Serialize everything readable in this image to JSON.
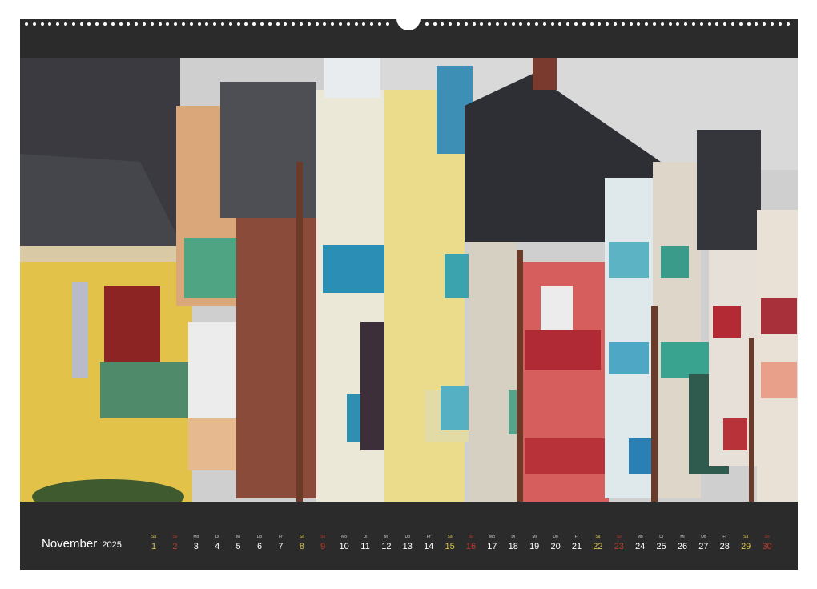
{
  "calendar": {
    "month": "November",
    "year": "2025",
    "days": [
      {
        "abbr": "Sa",
        "num": "1",
        "type": "sat"
      },
      {
        "abbr": "So",
        "num": "2",
        "type": "sun"
      },
      {
        "abbr": "Mo",
        "num": "3",
        "type": "week"
      },
      {
        "abbr": "Di",
        "num": "4",
        "type": "week"
      },
      {
        "abbr": "Mi",
        "num": "5",
        "type": "week"
      },
      {
        "abbr": "Do",
        "num": "6",
        "type": "week"
      },
      {
        "abbr": "Fr",
        "num": "7",
        "type": "week"
      },
      {
        "abbr": "Sa",
        "num": "8",
        "type": "sat"
      },
      {
        "abbr": "So",
        "num": "9",
        "type": "sun"
      },
      {
        "abbr": "Mo",
        "num": "10",
        "type": "week"
      },
      {
        "abbr": "Di",
        "num": "11",
        "type": "week"
      },
      {
        "abbr": "Mi",
        "num": "12",
        "type": "week"
      },
      {
        "abbr": "Do",
        "num": "13",
        "type": "week"
      },
      {
        "abbr": "Fr",
        "num": "14",
        "type": "week"
      },
      {
        "abbr": "Sa",
        "num": "15",
        "type": "sat"
      },
      {
        "abbr": "So",
        "num": "16",
        "type": "sun"
      },
      {
        "abbr": "Mo",
        "num": "17",
        "type": "week"
      },
      {
        "abbr": "Di",
        "num": "18",
        "type": "week"
      },
      {
        "abbr": "Mi",
        "num": "19",
        "type": "week"
      },
      {
        "abbr": "Do",
        "num": "20",
        "type": "week"
      },
      {
        "abbr": "Fr",
        "num": "21",
        "type": "week"
      },
      {
        "abbr": "Sa",
        "num": "22",
        "type": "sat"
      },
      {
        "abbr": "So",
        "num": "23",
        "type": "sun"
      },
      {
        "abbr": "Mo",
        "num": "24",
        "type": "week"
      },
      {
        "abbr": "Di",
        "num": "25",
        "type": "week"
      },
      {
        "abbr": "Mi",
        "num": "26",
        "type": "week"
      },
      {
        "abbr": "Do",
        "num": "27",
        "type": "week"
      },
      {
        "abbr": "Fr",
        "num": "28",
        "type": "week"
      },
      {
        "abbr": "Sa",
        "num": "29",
        "type": "sat"
      },
      {
        "abbr": "So",
        "num": "30",
        "type": "sun"
      }
    ]
  },
  "photo": {
    "subject": "colorful-seaside-townhouses-photo"
  },
  "colors": {
    "frame": "#2b2b2b",
    "saturday": "#d8c24a",
    "sunday": "#c0392b",
    "weekday": "#ffffff"
  }
}
